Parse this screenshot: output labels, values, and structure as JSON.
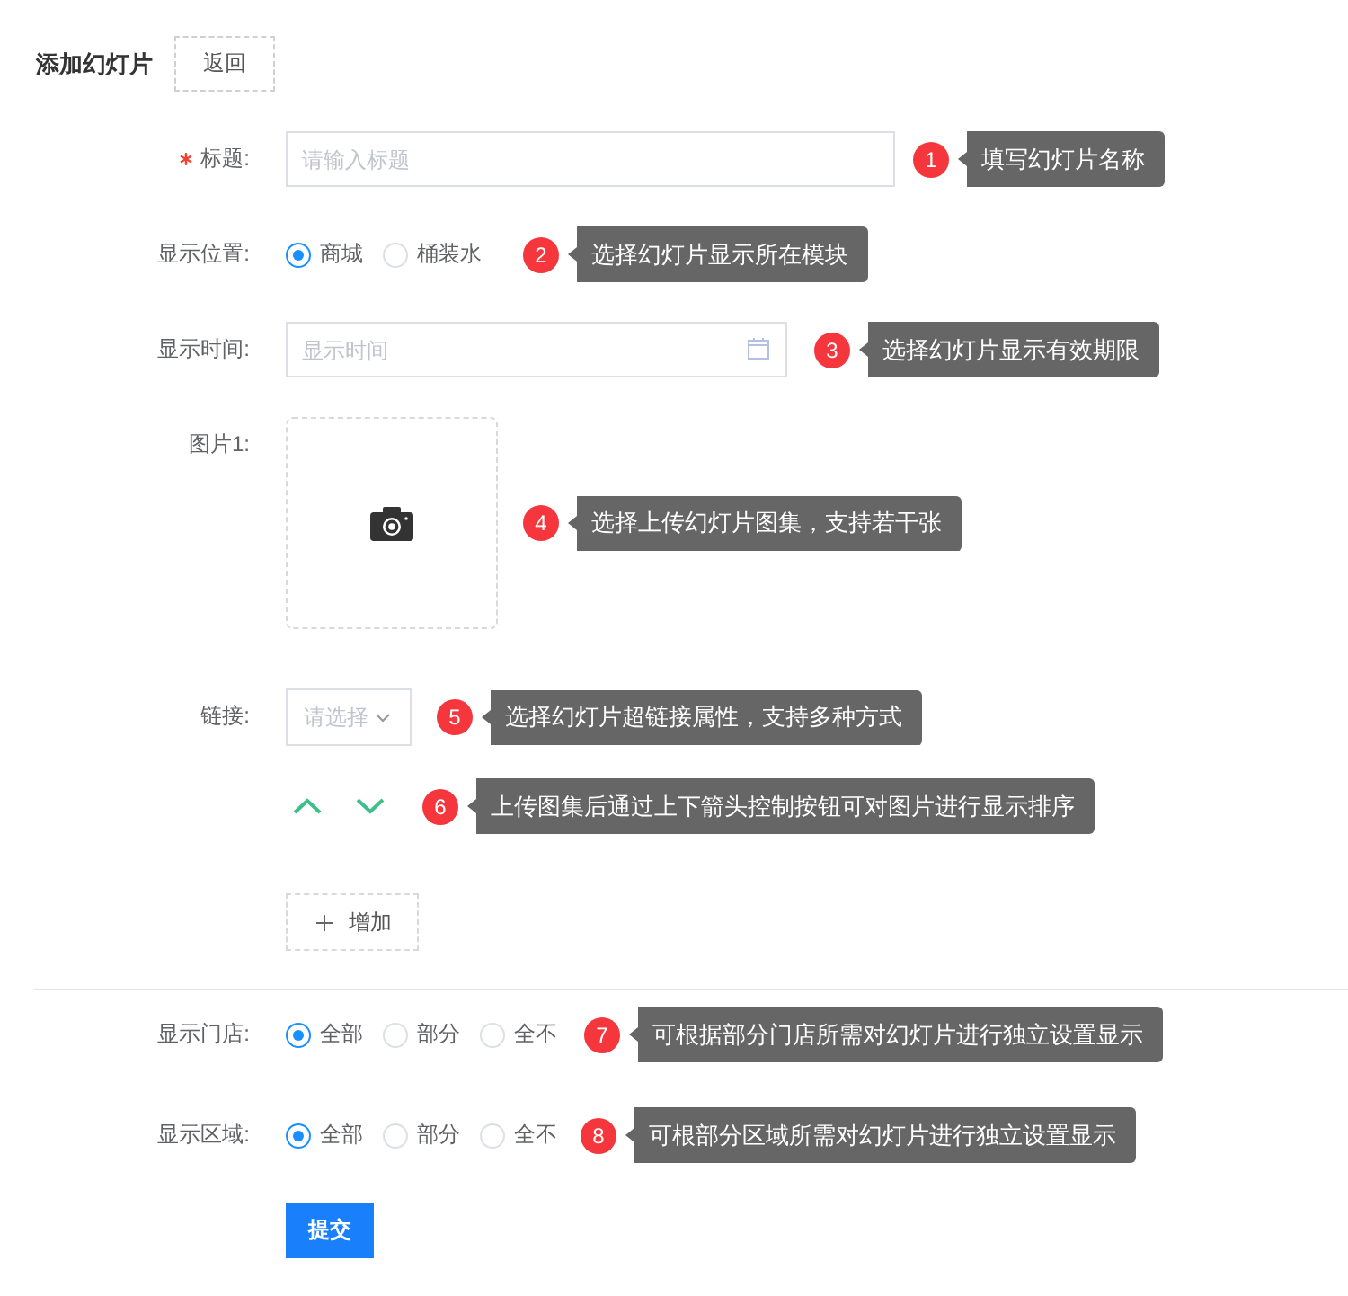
{
  "header": {
    "title": "添加幻灯片",
    "back_button": "返回"
  },
  "fields": [
    {
      "kind": "text",
      "label": "标题:",
      "required": true,
      "placeholder": "请输入标题",
      "callout": {
        "number": "1",
        "text": "填写幻灯片名称"
      }
    },
    {
      "kind": "radio",
      "label": "显示位置:",
      "required": false,
      "options": [
        {
          "label": "商城",
          "selected": true
        },
        {
          "label": "桶装水",
          "selected": false
        }
      ],
      "callout": {
        "number": "2",
        "text": "选择幻灯片显示所在模块"
      }
    },
    {
      "kind": "date",
      "label": "显示时间:",
      "required": false,
      "placeholder": "显示时间",
      "callout": {
        "number": "3",
        "text": "选择幻灯片显示有效期限"
      }
    },
    {
      "kind": "upload",
      "label": "图片1:",
      "required": false,
      "callout": {
        "number": "4",
        "text": "选择上传幻灯片图集，支持若干张"
      }
    },
    {
      "kind": "select",
      "label": "链接:",
      "required": false,
      "placeholder": "请选择",
      "callout": {
        "number": "5",
        "text": "选择幻灯片超链接属性，支持多种方式"
      }
    },
    {
      "kind": "sort",
      "callout": {
        "number": "6",
        "text": "上传图集后通过上下箭头控制按钮可对图片进行显示排序"
      }
    },
    {
      "kind": "add",
      "button": "增加"
    }
  ],
  "visibility": [
    {
      "label": "显示门店:",
      "options": [
        {
          "label": "全部",
          "selected": true
        },
        {
          "label": "部分",
          "selected": false
        },
        {
          "label": "全不",
          "selected": false
        }
      ],
      "callout": {
        "number": "7",
        "text": "可根据部分门店所需对幻灯片进行独立设置显示"
      }
    },
    {
      "label": "显示区域:",
      "options": [
        {
          "label": "全部",
          "selected": true
        },
        {
          "label": "部分",
          "selected": false
        },
        {
          "label": "全不",
          "selected": false
        }
      ],
      "callout": {
        "number": "8",
        "text": "可根部分区域所需对幻灯片进行独立设置显示"
      }
    }
  ],
  "submit_button": "提交"
}
